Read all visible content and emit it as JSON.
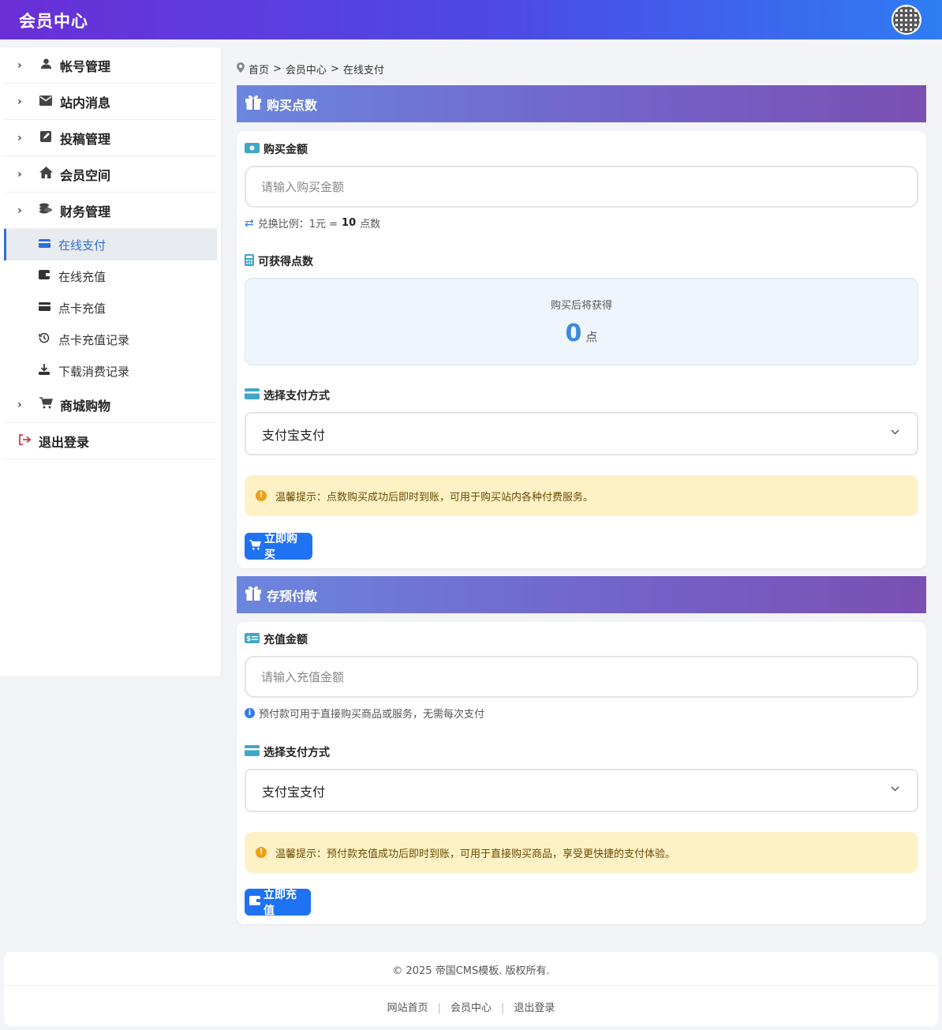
{
  "header": {
    "brand": "会员中心"
  },
  "sidebar": {
    "items": [
      {
        "label": "帐号管理"
      },
      {
        "label": "站内消息"
      },
      {
        "label": "投稿管理"
      },
      {
        "label": "会员空间"
      },
      {
        "label": "财务管理"
      }
    ],
    "finance_sub": [
      {
        "label": "在线支付"
      },
      {
        "label": "在线充值"
      },
      {
        "label": "点卡充值"
      },
      {
        "label": "点卡充值记录"
      },
      {
        "label": "下载消费记录"
      }
    ],
    "shop": "商城购物",
    "logout": "退出登录"
  },
  "breadcrumb": {
    "home": "首页",
    "sep1": ">",
    "center": "会员中心",
    "sep2": ">",
    "current": "在线支付"
  },
  "buy_points": {
    "title": "购买点数",
    "amount_label": "购买金额",
    "amount_placeholder": "请输入购买金额",
    "ratio_prefix": "兑换比例：1元 =",
    "ratio_value": "10",
    "ratio_suffix": "点数",
    "obtain_label": "可获得点数",
    "obtain_caption": "购买后将获得",
    "obtain_value": "0",
    "obtain_unit": "点",
    "pay_label": "选择支付方式",
    "pay_selected": "支付宝支付",
    "notice": "温馨提示：点数购买成功后即时到账，可用于购买站内各种付费服务。",
    "button": "立即购买"
  },
  "prepay": {
    "title": "存预付款",
    "amount_label": "充值金额",
    "amount_placeholder": "请输入充值金额",
    "hint": "预付款可用于直接购买商品或服务，无需每次支付",
    "pay_label": "选择支付方式",
    "pay_selected": "支付宝支付",
    "notice": "温馨提示：预付款充值成功后即时到账，可用于直接购买商品，享受更快捷的支付体验。",
    "button": "立即充值"
  },
  "footer": {
    "copyright": "© 2025 帝国CMS模板. 版权所有.",
    "links": [
      "网站首页",
      "会员中心",
      "退出登录"
    ],
    "sep": "|"
  },
  "colors": {
    "header_start": "#6a2fd6",
    "header_end": "#2f7cf3",
    "accent": "#1f72f2",
    "active": "#2f6fd6"
  },
  "icons": [
    "user-icon",
    "envelope-icon",
    "edit-icon",
    "home-icon",
    "coins-icon",
    "credit-card-icon",
    "wallet-icon",
    "history-icon",
    "download-icon",
    "cart-icon",
    "sign-out-icon",
    "gift-icon",
    "money-icon",
    "calculator-icon",
    "exchange-icon",
    "info-icon",
    "warning-icon",
    "chevron-down-icon",
    "chevron-right-icon",
    "map-pin-icon"
  ]
}
